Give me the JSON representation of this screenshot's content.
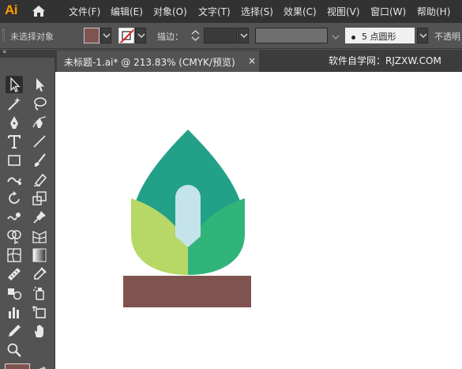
{
  "app": {
    "logo": "Ai"
  },
  "menu": [
    "文件(F)",
    "编辑(E)",
    "对象(O)",
    "文字(T)",
    "选择(S)",
    "效果(C)",
    "视图(V)",
    "窗口(W)",
    "帮助(H)"
  ],
  "control": {
    "selection_label": "未选择对象",
    "stroke_label": "描边：",
    "brush_label": "5 点圆形",
    "opacity_label": "不透明",
    "fill_color": "#7f5450",
    "stroke_state": "none"
  },
  "tab": {
    "title": "未标题-1.ai* @ 213.83% (CMYK/预览)",
    "close": "×"
  },
  "watermark": "软件自学网：RJZXW.COM",
  "tools": [
    "selection-tool",
    "direct-selection-tool",
    "magic-wand-tool",
    "lasso-tool",
    "pen-tool",
    "curvature-tool",
    "type-tool",
    "line-segment-tool",
    "rectangle-tool",
    "paintbrush-tool",
    "shaper-tool",
    "eraser-tool",
    "rotate-tool",
    "scale-tool",
    "warp-tool",
    "pin-tool",
    "shape-builder-tool",
    "perspective-grid-tool",
    "mesh-tool",
    "gradient-tool",
    "measure-tool",
    "eyedropper-tool",
    "blend-tool",
    "symbol-sprayer-tool",
    "column-graph-tool",
    "artboard-tool",
    "slice-tool",
    "hand-tool",
    "zoom-tool"
  ],
  "artwork": {
    "leaf_top_color": "#23a088",
    "leaf_left_color": "#b7d767",
    "leaf_right_color": "#31b47a",
    "stem_color": "#c4e3ea",
    "pot_color": "#7f5450"
  }
}
